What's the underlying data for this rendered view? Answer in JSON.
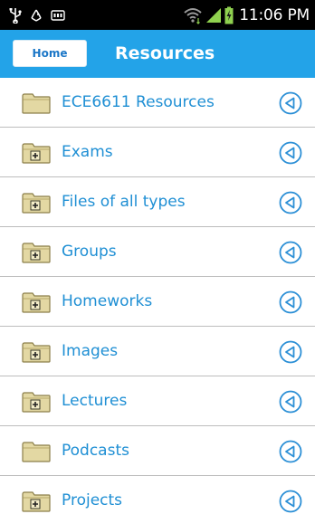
{
  "status_bar": {
    "time": "11:06 PM",
    "left_icons": [
      "usb-icon",
      "recycle-icon",
      "sd-card-icon"
    ],
    "right_icons": [
      "wifi-icon",
      "signal-icon",
      "battery-charging-icon"
    ]
  },
  "header": {
    "home_label": "Home",
    "title": "Resources",
    "background_color": "#23a3e8"
  },
  "list": {
    "items": [
      {
        "label": "ECE6611 Resources",
        "icon": "folder-icon"
      },
      {
        "label": "Exams",
        "icon": "folder-plus-icon"
      },
      {
        "label": "Files of all types",
        "icon": "folder-plus-icon"
      },
      {
        "label": "Groups",
        "icon": "folder-plus-icon"
      },
      {
        "label": "Homeworks",
        "icon": "folder-plus-icon"
      },
      {
        "label": "Images",
        "icon": "folder-plus-icon"
      },
      {
        "label": "Lectures",
        "icon": "folder-plus-icon"
      },
      {
        "label": "Podcasts",
        "icon": "folder-icon"
      },
      {
        "label": "Projects",
        "icon": "folder-plus-icon"
      }
    ],
    "action_icon": "circle-arrow-left-icon",
    "label_color": "#1f8fd4"
  }
}
